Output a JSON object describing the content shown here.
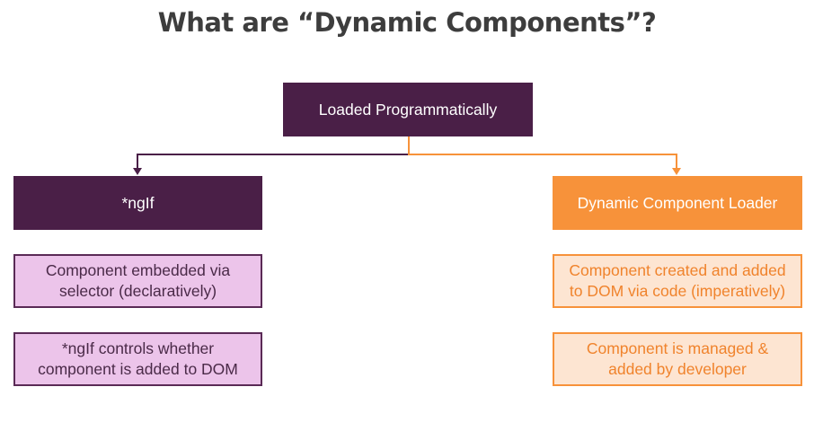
{
  "title": "What are “Dynamic Components”?",
  "root": {
    "label": "Loaded Programmatically"
  },
  "left": {
    "header": "*ngIf",
    "items": [
      "Component embedded via selector (declaratively)",
      "*ngIf controls whether component is added to DOM"
    ]
  },
  "right": {
    "header": "Dynamic Component Loader",
    "items": [
      "Component created and added to DOM via code (imperatively)",
      "Component is managed & added by developer"
    ]
  },
  "colors": {
    "dark_purple": "#4a1f47",
    "orange": "#f7923a",
    "lilac": "#ecc4ea",
    "peach": "#fde5d2"
  }
}
